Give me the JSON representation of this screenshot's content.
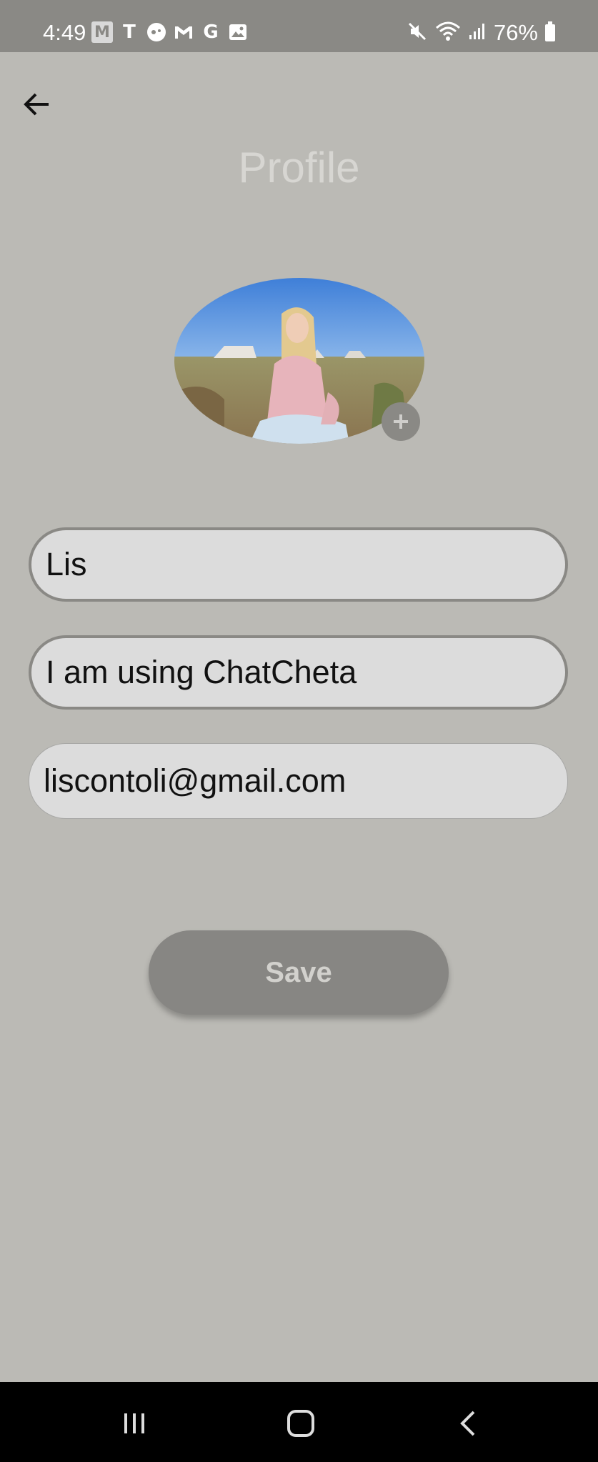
{
  "status_bar": {
    "time": "4:49",
    "battery": "76%",
    "notification_icons": [
      "gmail-m-icon",
      "t-mobile-icon",
      "game-controller-icon",
      "gmail-icon",
      "google-g-icon",
      "gallery-icon"
    ],
    "system_icons": [
      "mute-icon",
      "wifi-icon",
      "signal-icon",
      "battery-icon"
    ]
  },
  "header": {
    "title": "Profile",
    "back_icon": "arrow-left-icon"
  },
  "avatar": {
    "add_icon": "plus-icon"
  },
  "form": {
    "name_value": "Lis",
    "status_value": "I am using ChatCheta",
    "email_value": "liscontoli@gmail.com"
  },
  "actions": {
    "save_label": "Save"
  },
  "nav_bar": {
    "recents_icon": "recents-icon",
    "home_icon": "home-icon",
    "back_icon": "back-chevron-icon"
  },
  "colors": {
    "background": "#bbbab5",
    "status_bar": "#8a8985",
    "field_fill": "#dcdcdc",
    "button": "#878683",
    "title": "#d7d6d2"
  }
}
